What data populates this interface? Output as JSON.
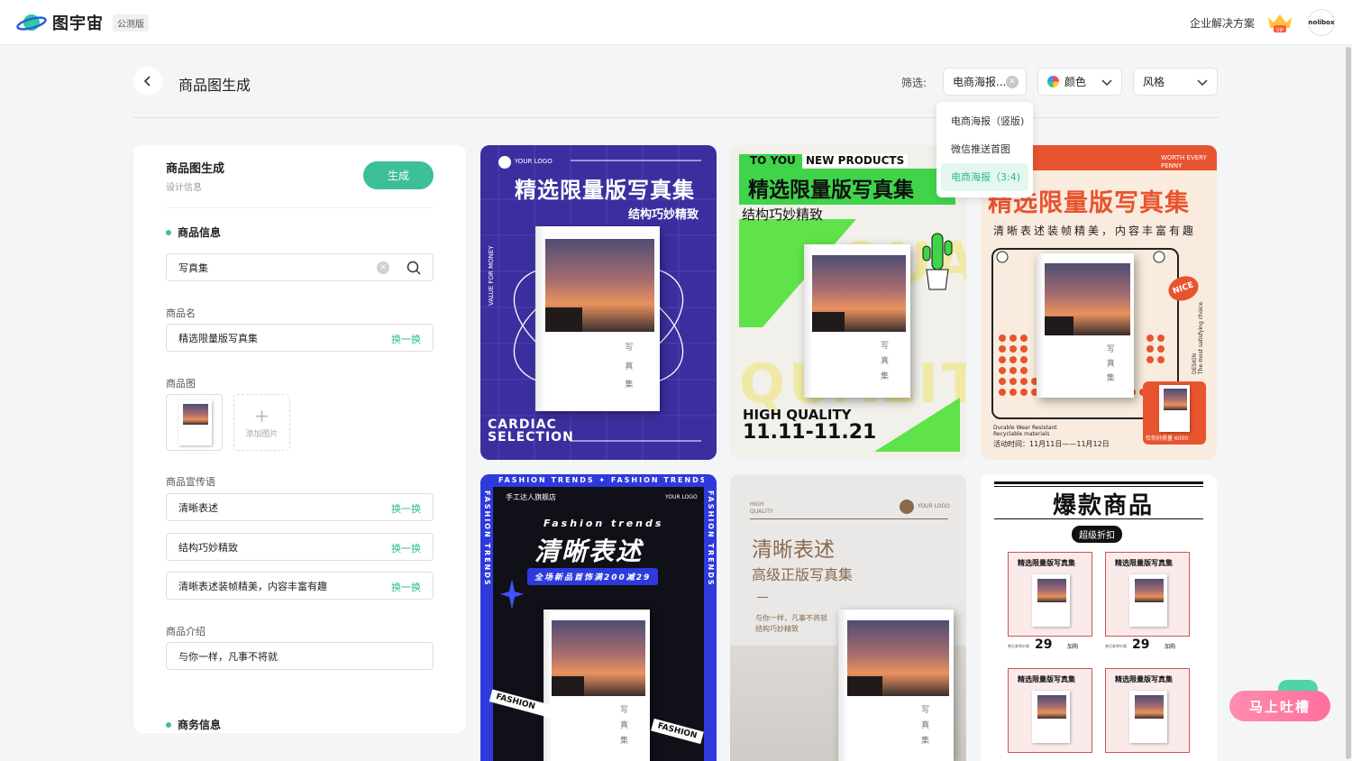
{
  "app": {
    "name": "图宇宙",
    "badge": "公测版",
    "enterprise_link": "企业解决方案",
    "vip_label": "VIP",
    "avatar_text": "nolibox"
  },
  "page": {
    "title": "商品图生成"
  },
  "filter": {
    "label": "筛选:",
    "type_value": "电商海报...",
    "color_label": "颜色",
    "style_label": "风格",
    "dropdown_options": [
      "电商海报（竖版)",
      "微信推送首图",
      "电商海报（3:4)"
    ],
    "dropdown_selected": "电商海报（3:4)"
  },
  "panel": {
    "title": "商品图生成",
    "subtitle": "设计信息",
    "generate_button": "生成",
    "section_product": "商品信息",
    "search_value": "写真集",
    "name_label": "商品名",
    "name_value": "精选限量版写真集",
    "swap_label": "换一换",
    "image_label": "商品图",
    "add_image": "添加图片",
    "slogan_label": "商品宣传语",
    "slogans": [
      "清晰表述",
      "结构巧妙精致",
      "清晰表述装帧精美，内容丰富有趣"
    ],
    "intro_label": "商品介绍",
    "intro_value": "与你一样，凡事不将就",
    "section_business": "商务信息"
  },
  "cards": {
    "c1": {
      "logo": "YOUR LOGO",
      "title": "精选限量版写真集",
      "subtitle": "结构巧妙精致",
      "side_text": "VALUE FOR MONEY",
      "bottom_1": "CARDIAC",
      "bottom_2": "SELECTION"
    },
    "c2": {
      "tag_1": "TO YOU",
      "tag_2": "NEW PRODUCTS",
      "title": "精选限量版写真集",
      "subtitle": "结构巧妙精致",
      "bg_text": "QUALITY",
      "quality": "HIGH QUALITY",
      "date": "11.11-11.21"
    },
    "c3": {
      "worth": "WORTH EVERY PENNY",
      "title": "精选限量版写真集",
      "subtitle": "清晰表述装帧精美，内容丰富有趣",
      "nice": "NICE",
      "design": "DESIGN",
      "design_sub": "The most satisfying choice",
      "foot_1": "Durable Wear Resistant",
      "foot_2": "Recyclable materials",
      "time": "活动时间：11月11日——11月12日",
      "price_tag": "恰你好质量 6000"
    },
    "c4": {
      "band": "FASHION TRENDS  ✦  FASHION TRENDS  ✦",
      "shop": "手工达人旗舰店",
      "logo": "YOUR LOGO",
      "script": "Fashion trends",
      "title": "清晰表述",
      "promo": "全场新品首饰满200减29",
      "side": "FASHION TRENDS",
      "ribbon": "FASHION"
    },
    "c5": {
      "tag": "HIGH QUALITY",
      "logo": "YOUR LOGO",
      "title": "清晰表述",
      "subtitle": "高级正版写真集",
      "line_1": "与你一样，凡事不将就",
      "line_2": "结构巧妙精致"
    },
    "c6": {
      "title": "爆款商品",
      "badge": "超级折扣",
      "item_name": "精选限量版写真集",
      "price": "29",
      "price_note": "券后参考价格",
      "buy": "加购"
    }
  },
  "book": {
    "char_1": "写",
    "char_2": "真",
    "char_3": "集"
  },
  "feedback": {
    "label": "马上吐槽"
  },
  "colors": {
    "accent": "#3dbf98",
    "feedback": "#ff7aa2"
  }
}
